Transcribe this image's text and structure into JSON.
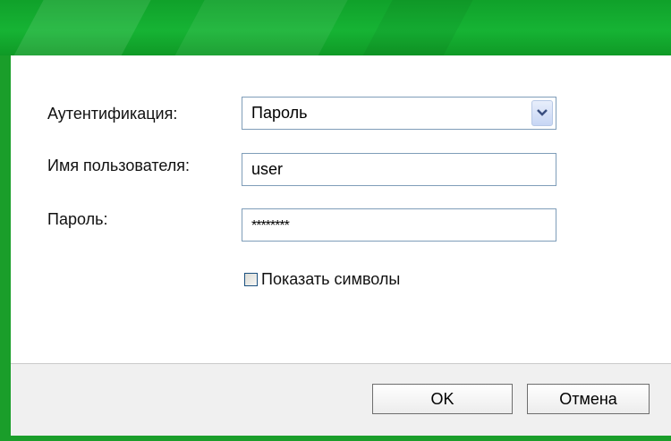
{
  "form": {
    "auth_label": "Аутентификация:",
    "auth_value": "Пароль",
    "username_label": "Имя пользователя:",
    "username_value": "user",
    "password_label": "Пароль:",
    "password_value": "********",
    "show_chars_label": "Показать символы",
    "show_chars_checked": false
  },
  "buttons": {
    "ok_label": "OK",
    "cancel_label": "Отмена"
  },
  "colors": {
    "header_green": "#16b334",
    "frame_green": "#1a9e2a",
    "field_border": "#7f9db9",
    "footer_bg": "#f0f0f0"
  }
}
